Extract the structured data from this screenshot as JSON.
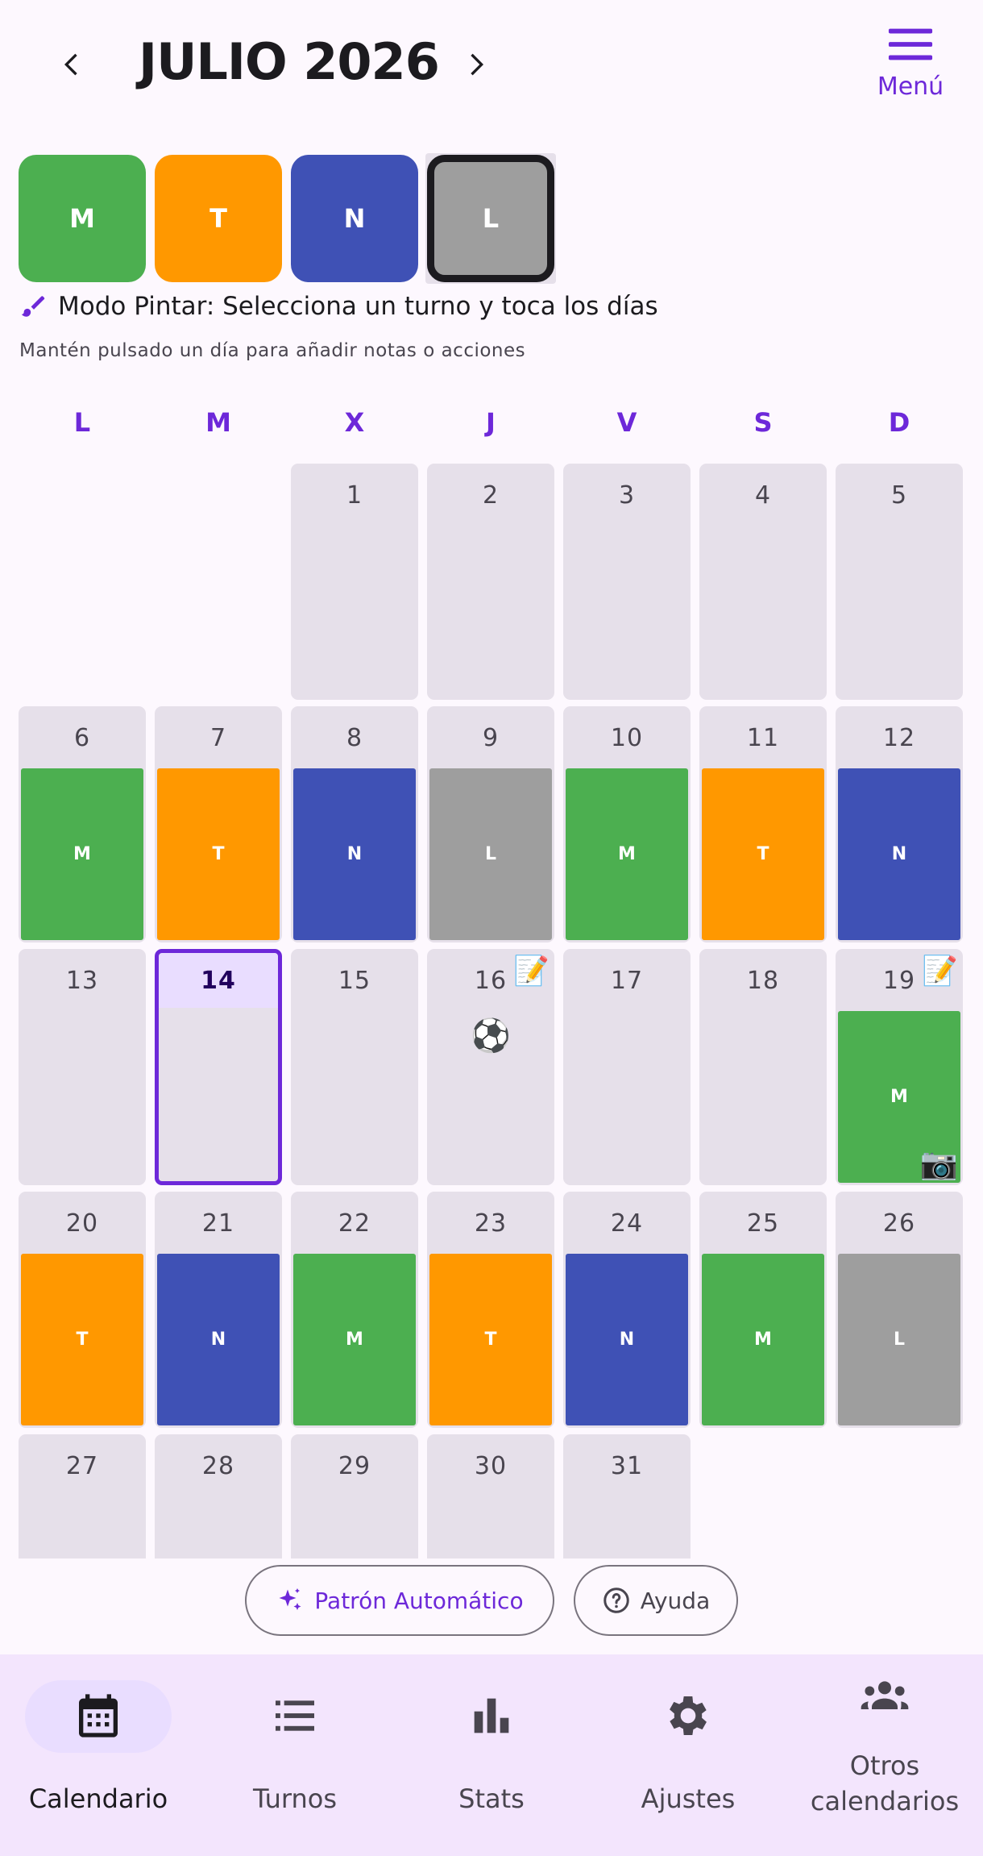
{
  "header": {
    "month_title": "JULIO 2026",
    "prev_icon": "chevron-left-icon",
    "next_icon": "chevron-right-icon",
    "menu_icon": "hamburger-menu-icon",
    "menu_label": "Menú"
  },
  "palette": [
    {
      "label": "M",
      "color": "#4caf50",
      "selected": false
    },
    {
      "label": "T",
      "color": "#ff9800",
      "selected": false
    },
    {
      "label": "N",
      "color": "#3f51b5",
      "selected": false
    },
    {
      "label": "L",
      "color": "#9e9e9e",
      "selected": true
    }
  ],
  "paint_mode": {
    "icon": "paintbrush-icon",
    "text": "Modo Pintar: Selecciona un turno y toca los días"
  },
  "hint": "Mantén pulsado un día para añadir notas o acciones",
  "weekdays": [
    "L",
    "M",
    "X",
    "J",
    "V",
    "S",
    "D"
  ],
  "calendar": {
    "leading_empty_days": 2,
    "today": 14,
    "days": [
      {
        "day": "1"
      },
      {
        "day": "2"
      },
      {
        "day": "3"
      },
      {
        "day": "4"
      },
      {
        "day": "5"
      },
      {
        "day": "6",
        "shift": "M"
      },
      {
        "day": "7",
        "shift": "T"
      },
      {
        "day": "8",
        "shift": "N"
      },
      {
        "day": "9",
        "shift": "L"
      },
      {
        "day": "10",
        "shift": "M"
      },
      {
        "day": "11",
        "shift": "T"
      },
      {
        "day": "12",
        "shift": "N"
      },
      {
        "day": "13"
      },
      {
        "day": "14"
      },
      {
        "day": "15"
      },
      {
        "day": "16",
        "note": "📝",
        "emoji": "⚽"
      },
      {
        "day": "17"
      },
      {
        "day": "18"
      },
      {
        "day": "19",
        "note": "📝",
        "shift": "M",
        "photo": "📷"
      },
      {
        "day": "20",
        "shift": "T"
      },
      {
        "day": "21",
        "shift": "N"
      },
      {
        "day": "22",
        "shift": "M"
      },
      {
        "day": "23",
        "shift": "T"
      },
      {
        "day": "24",
        "shift": "N"
      },
      {
        "day": "25",
        "shift": "M"
      },
      {
        "day": "26",
        "shift": "L"
      },
      {
        "day": "27"
      },
      {
        "day": "28"
      },
      {
        "day": "29"
      },
      {
        "day": "30"
      },
      {
        "day": "31"
      }
    ]
  },
  "shift_colors": {
    "M": "#4caf50",
    "T": "#ff9800",
    "N": "#3f51b5",
    "L": "#9e9e9e"
  },
  "actions": {
    "auto_pattern_label": "Patrón Automático",
    "auto_pattern_icon": "sparkles-icon",
    "help_label": "Ayuda",
    "help_icon": "help-circle-icon"
  },
  "bottom_nav": [
    {
      "label": "Calendario",
      "icon": "calendar-icon",
      "active": true
    },
    {
      "label": "Turnos",
      "icon": "list-icon",
      "active": false
    },
    {
      "label": "Stats",
      "icon": "bar-chart-icon",
      "active": false
    },
    {
      "label": "Ajustes",
      "icon": "gear-icon",
      "active": false
    },
    {
      "label": "Otros calendarios",
      "icon": "group-icon",
      "active": false
    }
  ],
  "accent_color": "#6d28d9"
}
